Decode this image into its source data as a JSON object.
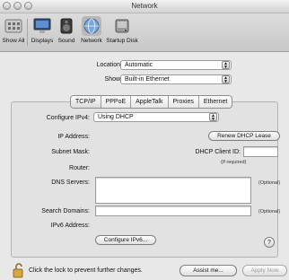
{
  "window": {
    "title": "Network"
  },
  "toolbar": {
    "items": [
      {
        "label": "Show All",
        "icon": "grid-icon"
      },
      {
        "label": "Displays",
        "icon": "display-icon"
      },
      {
        "label": "Sound",
        "icon": "speaker-icon"
      },
      {
        "label": "Network",
        "icon": "network-globe-icon"
      },
      {
        "label": "Startup Disk",
        "icon": "hard-disk-icon"
      }
    ]
  },
  "location": {
    "label": "Location:",
    "value": "Automatic"
  },
  "show": {
    "label": "Show:",
    "value": "Built-in Ethernet"
  },
  "tabs": [
    "TCP/IP",
    "PPPoE",
    "AppleTalk",
    "Proxies",
    "Ethernet"
  ],
  "configure_ipv4": {
    "label": "Configure IPv4:",
    "value": "Using DHCP"
  },
  "ip_address": {
    "label": "IP Address:"
  },
  "renew_button": "Renew DHCP Lease",
  "subnet_mask": {
    "label": "Subnet Mask:"
  },
  "dhcp_client_id": {
    "label": "DHCP Client ID:",
    "hint": "(If required)"
  },
  "router": {
    "label": "Router:"
  },
  "dns_servers": {
    "label": "DNS Servers:",
    "optional": "(Optional)"
  },
  "search_domains": {
    "label": "Search Domains:",
    "optional": "(Optional)"
  },
  "ipv6_address": {
    "label": "IPv6 Address:"
  },
  "configure_ipv6_button": "Configure IPv6...",
  "help_label": "?",
  "lock_text": "Click the lock to prevent further changes.",
  "assist_button": "Assist me...",
  "apply_button": "Apply Now"
}
